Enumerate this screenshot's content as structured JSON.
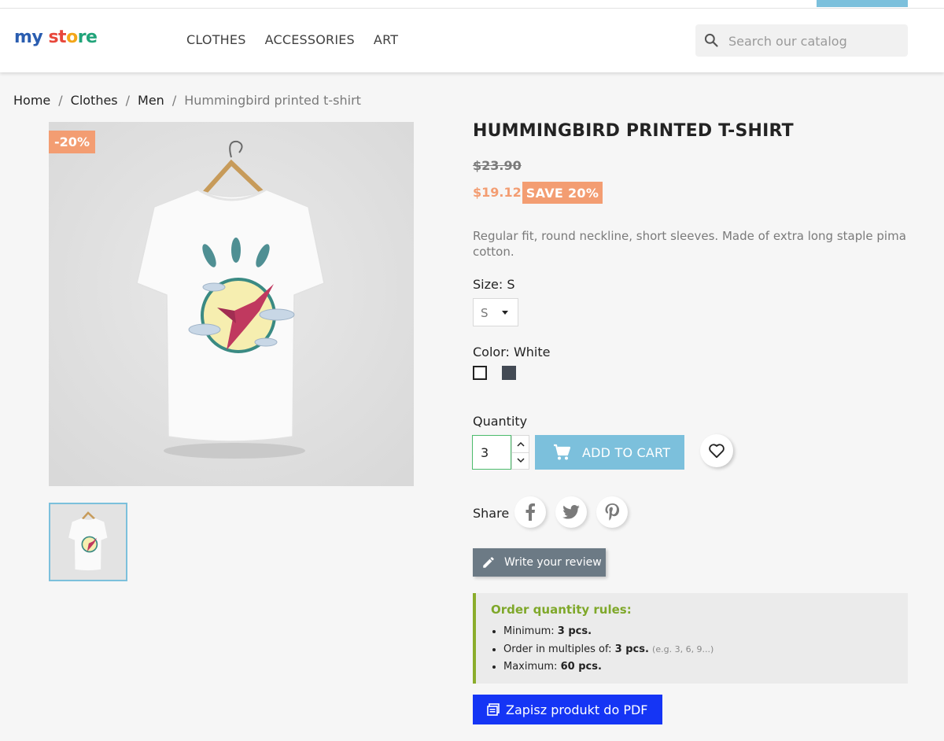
{
  "header": {
    "logo": {
      "part1": "my",
      "part2": "st",
      "part3": "o",
      "part4": "re"
    },
    "nav": [
      "CLOTHES",
      "ACCESSORIES",
      "ART"
    ],
    "search_placeholder": "Search our catalog"
  },
  "breadcrumb": [
    "Home",
    "Clothes",
    "Men",
    "Hummingbird printed t-shirt"
  ],
  "product": {
    "discount_flag": "-20%",
    "title": "HUMMINGBIRD PRINTED T-SHIRT",
    "old_price": "$23.90",
    "new_price": "$19.12",
    "save_badge": "SAVE 20%",
    "description": "Regular fit, round neckline, short sleeves. Made of extra long staple pima cotton.",
    "size_label": "Size: S",
    "size_value": "S",
    "color_label": "Color: White",
    "colors": [
      "#ffffff",
      "#434a54"
    ],
    "quantity_label": "Quantity",
    "quantity_value": "3",
    "add_to_cart": "ADD TO CART",
    "share_label": "Share",
    "write_review": "Write your review"
  },
  "rules": {
    "title": "Order quantity rules:",
    "min_label": "Minimum: ",
    "min_value": "3 pcs.",
    "multiple_label": "Order in multiples of: ",
    "multiple_value": "3 pcs.",
    "multiple_example": "(e.g. 3, 6, 9...)",
    "max_label": "Maximum: ",
    "max_value": "60 pcs."
  },
  "pdf_button": "Zapisz produkt do PDF",
  "colors": {
    "accent": "#7cc0dc",
    "sale": "#f39d72",
    "rules_border": "#8bad2c",
    "pdf": "#1535f5"
  }
}
